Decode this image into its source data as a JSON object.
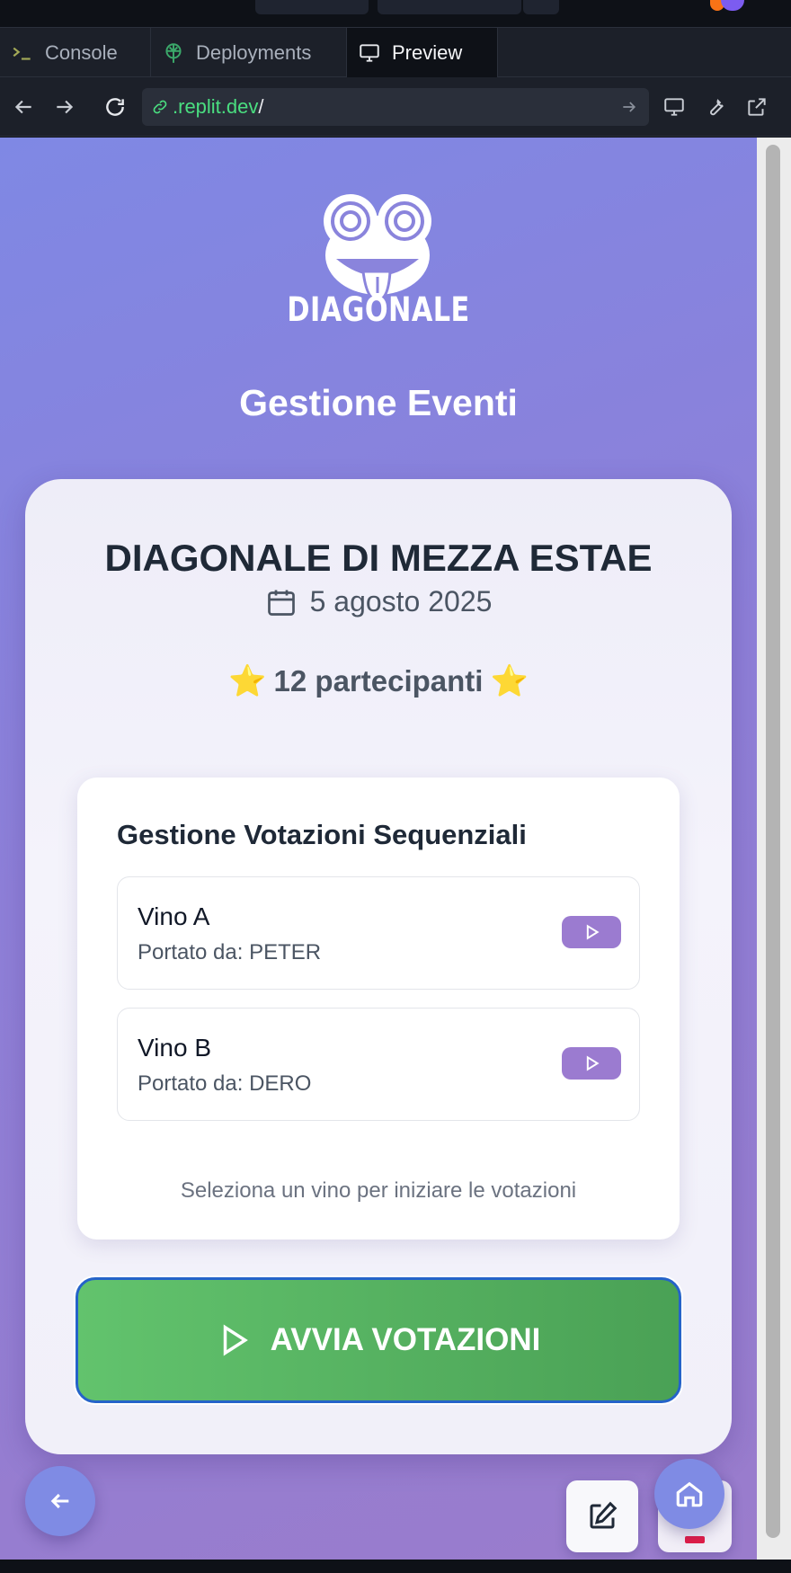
{
  "tabs": [
    {
      "label": "Console",
      "icon": "terminal-icon"
    },
    {
      "label": "Deployments",
      "icon": "deployments-icon"
    },
    {
      "label": "Preview",
      "icon": "monitor-icon",
      "active": true
    }
  ],
  "urlbar": {
    "host": ".replit.dev",
    "path": "/"
  },
  "app": {
    "brand": "DIAGONALE",
    "title": "Gestione Eventi"
  },
  "event": {
    "name": "DIAGONALE DI MEZZA ESTAE",
    "date": "5 agosto 2025",
    "participants": "12 partecipanti",
    "star": "⭐"
  },
  "voting": {
    "title": "Gestione Votazioni Sequenziali",
    "wines": [
      {
        "name": "Vino A",
        "brought_by": "Portato da: PETER"
      },
      {
        "name": "Vino B",
        "brought_by": "Portato da: DERO"
      }
    ],
    "hint": "Seleziona un vino per iniziare le votazioni",
    "start_label": "AVVIA VOTAZIONI"
  },
  "colors": {
    "accent": "#8a84dc",
    "start_button": "#58b562",
    "play_button": "#9b7bd0"
  }
}
